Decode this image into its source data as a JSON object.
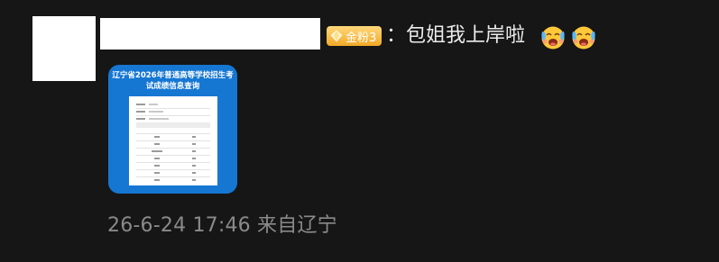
{
  "comment": {
    "badge_label": "金粉3",
    "text": "：包姐我上岸啦",
    "emojis": [
      "happy-cry-emoji",
      "happy-cry-emoji"
    ]
  },
  "image": {
    "title_line1": "辽宁省2026年普通高等学校招生考",
    "title_line2": "试成绩信息查询"
  },
  "meta": {
    "time_location": "26-6-24 17:46 来自辽宁"
  },
  "colors": {
    "background": "#161616",
    "badge": "#f1a928",
    "thumb_blue": "#1677d3",
    "meta_text": "#8a8a8a"
  }
}
